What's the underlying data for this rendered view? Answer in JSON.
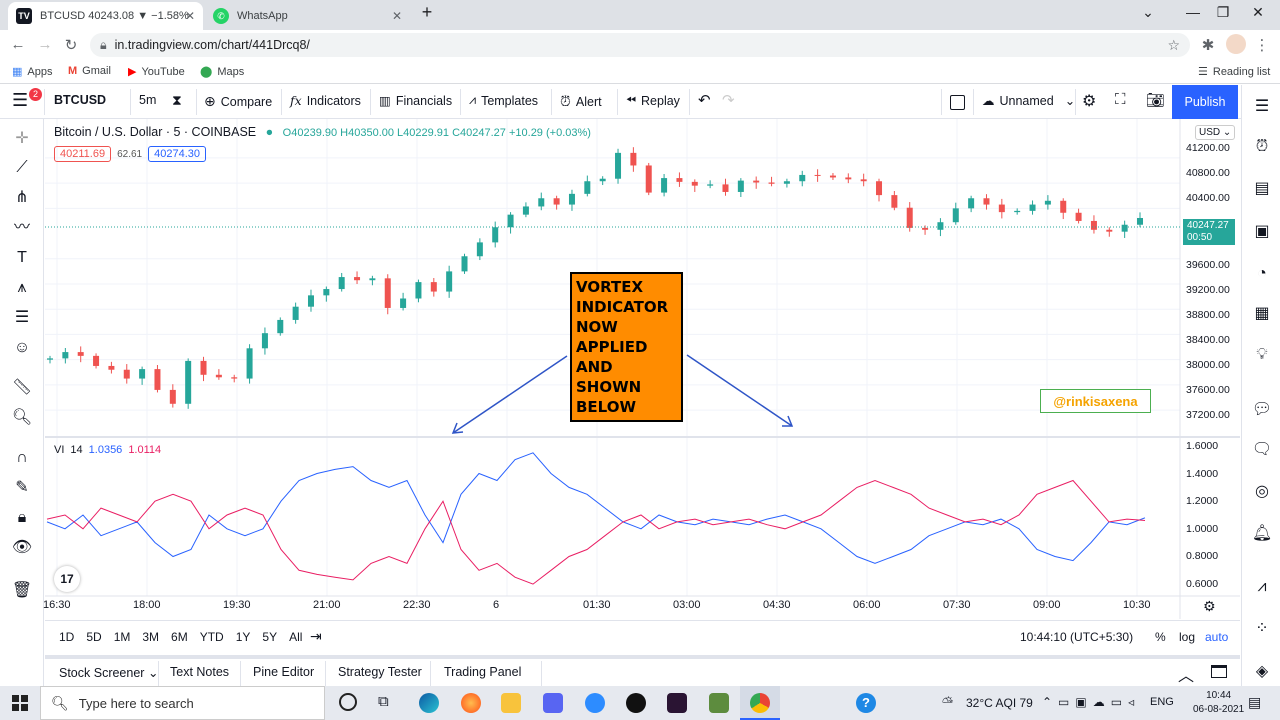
{
  "browser": {
    "tabs": [
      {
        "title": "BTCUSD 40243.08 ▼ −1.58% Unn",
        "active": true
      },
      {
        "title": "WhatsApp",
        "active": false
      }
    ],
    "url": "in.tradingview.com/chart/441Drcq8/",
    "bookmarks": [
      "Apps",
      "Gmail",
      "YouTube",
      "Maps"
    ],
    "reading_list": "Reading list"
  },
  "toolbar": {
    "symbol": "BTCUSD",
    "interval": "5m",
    "compare": "Compare",
    "indicators": "Indicators",
    "financials": "Financials",
    "templates": "Templates",
    "alert": "Alert",
    "replay": "Replay",
    "layout_name": "Unnamed",
    "publish": "Publish",
    "menu_badge": "2"
  },
  "legend": {
    "title": "Bitcoin / U.S. Dollar · 5 · COINBASE",
    "ohlc": "O40239.90 H40350.00 L40229.91 C40247.27 +10.29 (+0.03%)",
    "bid": "40211.69",
    "spread": "62.61",
    "ask": "40274.30",
    "indicator_name": "VI",
    "indicator_len": "14",
    "vi_plus": "1.0356",
    "vi_minus": "1.0114"
  },
  "price_axis": {
    "currency": "USD",
    "ticks": [
      "41200.00",
      "40800.00",
      "40400.00",
      "39600.00",
      "39200.00",
      "38800.00",
      "38400.00",
      "38000.00",
      "37600.00",
      "37200.00"
    ],
    "last_price": "40247.27",
    "countdown": "00:50",
    "vi_ticks": [
      "1.6000",
      "1.4000",
      "1.2000",
      "1.0000",
      "0.8000",
      "0.6000"
    ]
  },
  "time_axis": [
    "16:30",
    "18:00",
    "19:30",
    "21:00",
    "22:30",
    "6",
    "01:30",
    "03:00",
    "04:30",
    "06:00",
    "07:30",
    "09:00",
    "10:30"
  ],
  "range_bar": {
    "ranges": [
      "1D",
      "5D",
      "1M",
      "3M",
      "6M",
      "YTD",
      "1Y",
      "5Y",
      "All"
    ],
    "clock": "10:44:10 (UTC+5:30)",
    "percent": "%",
    "log": "log",
    "auto": "auto"
  },
  "bottom_panel": [
    "Stock Screener",
    "Text Notes",
    "Pine Editor",
    "Strategy Tester",
    "Trading Panel"
  ],
  "annotation": {
    "lines": [
      "VORTEX",
      "INDICATOR",
      "NOW",
      "APPLIED",
      "AND",
      "SHOWN",
      "BELOW"
    ],
    "watermark": "@rinkisaxena"
  },
  "taskbar": {
    "search_placeholder": "Type here to search",
    "weather": "32°C AQI 79",
    "lang": "ENG",
    "time": "10:44",
    "date": "06-08-2021"
  },
  "colors": {
    "up": "#26a69a",
    "down": "#ef5350",
    "vi_plus": "#2962ff",
    "vi_minus": "#e91e63",
    "accent": "#2962ff",
    "note_bg": "#ff8c00"
  },
  "chart_data": {
    "type": "candlestick",
    "symbol": "BTCUSD",
    "price_range": [
      36900,
      41500
    ],
    "close_series": [
      38020,
      38120,
      38060,
      37900,
      37840,
      37700,
      37850,
      37520,
      37300,
      37980,
      37760,
      37720,
      37700,
      38180,
      38420,
      38630,
      38840,
      39020,
      39120,
      39310,
      39260,
      39290,
      38820,
      38970,
      39230,
      39080,
      39400,
      39640,
      39860,
      40100,
      40300,
      40430,
      40560,
      40460,
      40630,
      40830,
      40870,
      41280,
      41080,
      40650,
      40880,
      40820,
      40760,
      40780,
      40660,
      40840,
      40810,
      40790,
      40830,
      40930,
      40920,
      40890,
      40860,
      40830,
      40610,
      40410,
      40090,
      40060,
      40180,
      40400,
      40560,
      40460,
      40340,
      40360,
      40460,
      40520,
      40330,
      40200,
      40060,
      40030,
      40140,
      40247
    ],
    "vortex": {
      "period": 14,
      "vi_plus_last": 1.0356,
      "vi_minus_last": 1.0114,
      "range": [
        0.5,
        1.6
      ],
      "vi_plus": [
        1.0,
        0.95,
        1.05,
        0.9,
        0.95,
        1.0,
        0.85,
        0.75,
        0.8,
        1.05,
        0.95,
        0.9,
        0.95,
        1.15,
        1.3,
        1.35,
        1.38,
        1.4,
        1.3,
        1.25,
        1.3,
        1.05,
        0.85,
        1.2,
        1.35,
        1.3,
        1.45,
        1.5,
        1.35,
        1.25,
        1.2,
        1.1,
        1.0,
        0.95,
        1.05,
        1.0,
        0.98,
        1.02,
        1.0,
        0.98,
        1.02,
        1.05,
        1.0,
        0.95,
        0.85,
        0.75,
        0.7,
        0.75,
        0.8,
        0.9,
        0.95,
        1.0,
        0.98,
        1.02,
        0.95,
        0.8,
        0.75,
        0.72,
        0.85,
        1.0,
        0.98,
        1.03
      ],
      "vi_minus": [
        1.02,
        1.05,
        0.95,
        1.1,
        1.05,
        1.0,
        1.15,
        1.2,
        1.15,
        0.95,
        1.05,
        1.1,
        1.05,
        0.8,
        0.65,
        0.62,
        0.6,
        0.58,
        0.7,
        0.75,
        0.7,
        0.95,
        1.15,
        0.8,
        0.65,
        0.7,
        0.6,
        0.55,
        0.65,
        0.75,
        0.8,
        0.9,
        1.0,
        1.05,
        0.95,
        1.0,
        1.02,
        0.98,
        1.0,
        1.02,
        0.98,
        0.95,
        1.0,
        1.05,
        1.15,
        1.25,
        1.3,
        1.25,
        1.2,
        1.1,
        1.05,
        1.0,
        1.02,
        0.98,
        1.05,
        1.2,
        1.25,
        1.3,
        1.15,
        1.0,
        1.02,
        1.01
      ]
    }
  }
}
